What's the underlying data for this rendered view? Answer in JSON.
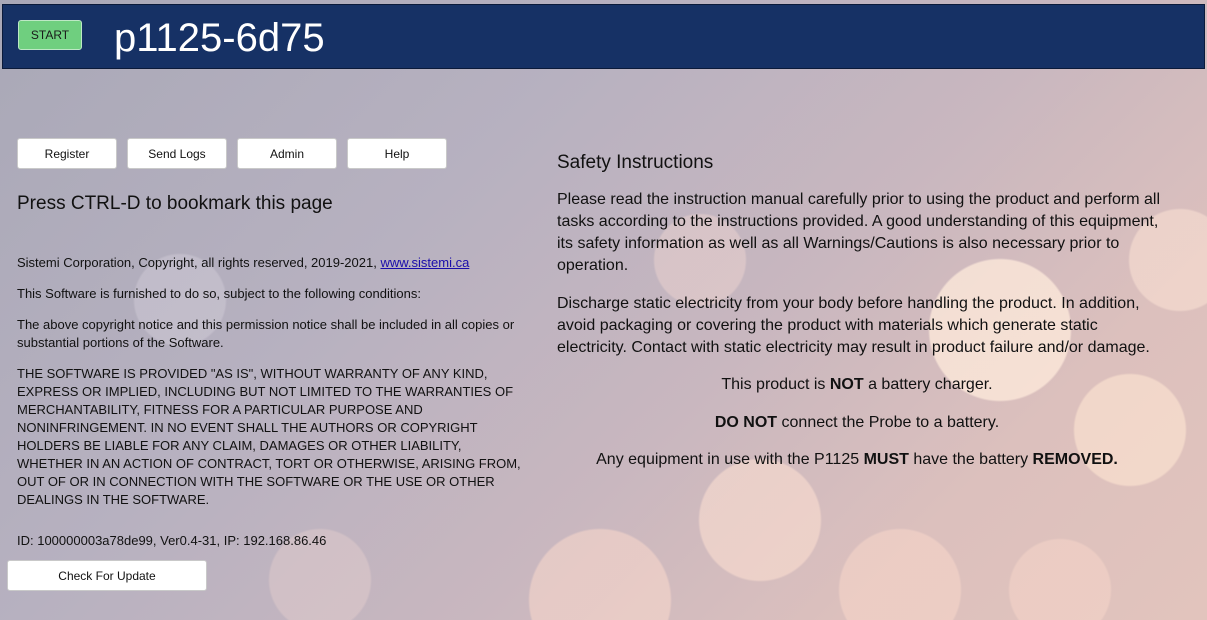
{
  "header": {
    "start_label": "START",
    "title": "p1125-6d75",
    "background": "#163165",
    "start_color": "#6fcf7f"
  },
  "nav": {
    "register": "Register",
    "send_logs": "Send Logs",
    "admin": "Admin",
    "help": "Help"
  },
  "left": {
    "bookmark": "Press CTRL-D to bookmark this page",
    "copyright": "Sistemi Corporation, Copyright, all rights reserved, 2019-2021,",
    "link": "www.sistemi.ca",
    "furnished": "This Software is furnished to do so, subject to the following conditions:",
    "notice": "The above copyright notice and this permission notice shall be included in all copies or substantial portions of the Software.",
    "warranty": "THE SOFTWARE IS PROVIDED \"AS IS\", WITHOUT WARRANTY OF ANY KIND, EXPRESS OR IMPLIED, INCLUDING BUT NOT LIMITED TO THE WARRANTIES OF MERCHANTABILITY, FITNESS FOR A PARTICULAR PURPOSE AND NONINFRINGEMENT. IN NO EVENT SHALL THE AUTHORS OR COPYRIGHT HOLDERS BE LIABLE FOR ANY CLAIM, DAMAGES OR OTHER LIABILITY, WHETHER IN AN ACTION OF CONTRACT, TORT OR OTHERWISE, ARISING FROM, OUT OF OR IN CONNECTION WITH THE SOFTWARE OR THE USE OR OTHER DEALINGS IN THE SOFTWARE.",
    "id_line": "ID: 100000003a78de99, Ver0.4-31, IP: 192.168.86.46",
    "update_button": "Check For Update"
  },
  "safety": {
    "heading": "Safety Instructions",
    "para1": "Please read the instruction manual carefully prior to using the product and perform all tasks according to the instructions provided. A good understanding of this equipment, its safety information as well as all Warnings/Cautions is also necessary prior to operation.",
    "para2": "Discharge static electricity from your body before handling the product. In addition, avoid packaging or covering the product with materials which generate static electricity. Contact with static electricity may result in product failure and/or damage.",
    "line1_a": "This product is ",
    "line1_b": "NOT",
    "line1_c": " a battery charger.",
    "line2_a": "DO NOT",
    "line2_b": " connect the Probe to a battery.",
    "line3_a": "Any equipment in use with the P1125 ",
    "line3_b": "MUST",
    "line3_c": " have the battery ",
    "line3_d": "REMOVED."
  }
}
